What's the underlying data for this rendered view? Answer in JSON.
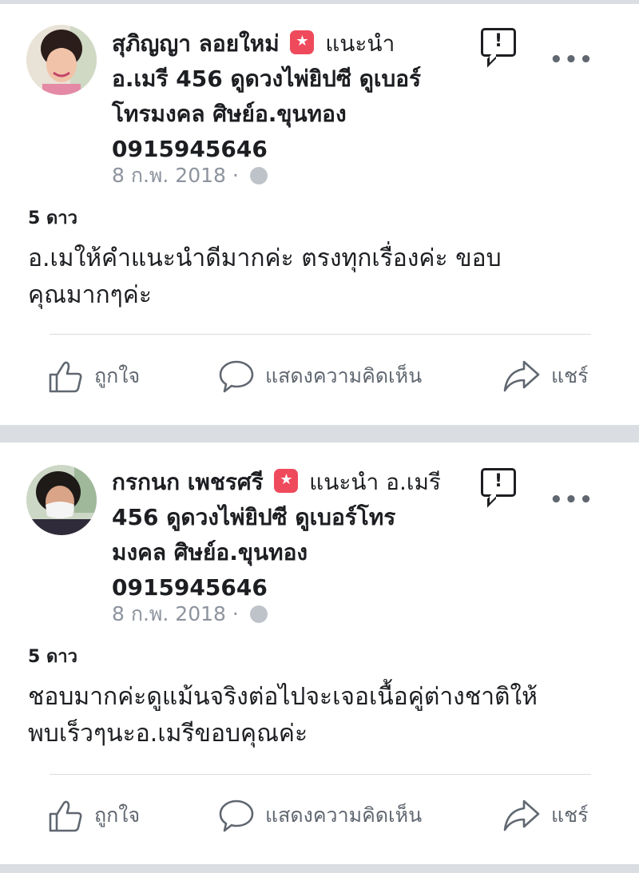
{
  "posts": [
    {
      "author": "สุภิญญา ลอยใหม่",
      "recommend_label": "แนะนำ",
      "page_name_lines": [
        "อ.เมรี 456 ดูดวงไพ่ยิปซี ดูเบอร์",
        "โทรมงคล ศิษย์อ.ขุนทอง",
        "0915945646"
      ],
      "date": "8 ก.พ. 2018 ·",
      "rating": "5 ดาว",
      "body_lines": [
        "อ.เมให้คำแนะนำดีมากค่ะ  ตรงทุกเรื่องค่ะ  ขอบ",
        "คุณมากๆค่ะ"
      ],
      "actions": {
        "like": "ถูกใจ",
        "comment": "แสดงความคิดเห็น",
        "share": "แชร์"
      }
    },
    {
      "author": "กรกนก เพชรศรี",
      "recommend_label": "แนะนำ อ.เมรี",
      "page_name_lines": [
        "456 ดูดวงไพ่ยิปซี ดูเบอร์โทร",
        "มงคล ศิษย์อ.ขุนทอง",
        "0915945646"
      ],
      "date": "8 ก.พ. 2018 ·",
      "rating": "5 ดาว",
      "body_lines": [
        "ชอบมากค่ะดูแม้นจริงต่อไปจะเจอเนื้อคู่ต่างชาติให้",
        "พบเร็วๆนะอ.เมรีขอบคุณค่ะ"
      ],
      "actions": {
        "like": "ถูกใจ",
        "comment": "แสดงความคิดเห็น",
        "share": "แชร์"
      }
    }
  ],
  "icons": {
    "star_badge": "star",
    "report": "!",
    "more": "•••"
  },
  "colors": {
    "badge": "#ef4a5c",
    "muted": "#606770",
    "separator": "#dadde1"
  }
}
